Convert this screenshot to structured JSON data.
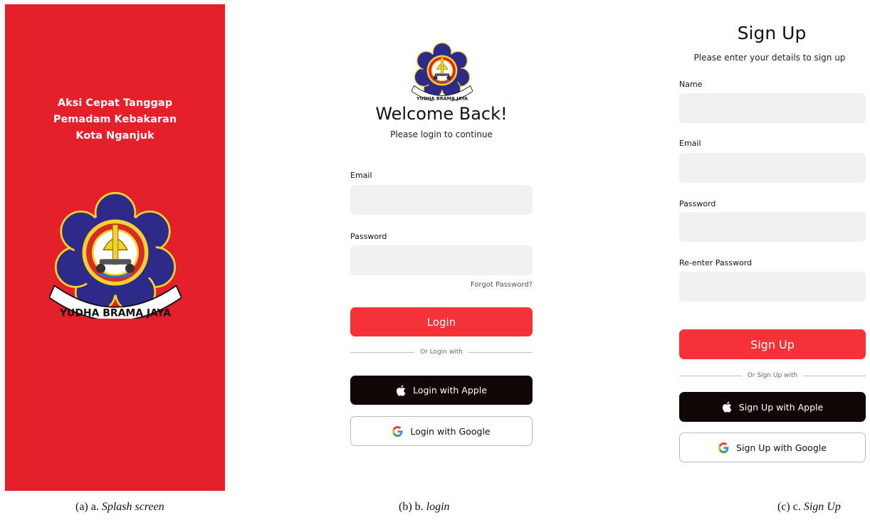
{
  "splash": {
    "title_lines": [
      "Aksi Cepat Tanggap",
      "Pemadam Kebakaran",
      "Kota Nganjuk"
    ],
    "logo_text": "YUDHA BRAMA JAYA",
    "bg_color": "#e4202a"
  },
  "login": {
    "title": "Welcome Back!",
    "subtitle": "Please login to continue",
    "email_label": "Email",
    "password_label": "Password",
    "email_value": "",
    "password_value": "",
    "forgot": "Forgot Password?",
    "login_button": "Login",
    "divider": "Or Login with",
    "apple_button": "Login with Apple",
    "google_button": "Login with Google"
  },
  "signup": {
    "title": "Sign Up",
    "subtitle": "Please enter your details to sign up",
    "name_label": "Name",
    "email_label": "Email",
    "password_label": "Password",
    "reenter_label": "Re-enter Password",
    "signup_button": "Sign Up",
    "divider": "Or Sign Up with",
    "apple_button": "Sign Up with Apple",
    "google_button": "Sign Up with Google"
  },
  "captions": {
    "a_prefix": "(a) a.",
    "a_name": "Splash screen",
    "b_prefix": "(b) b.",
    "b_name": "login",
    "c_prefix": "(c) c.",
    "c_name": "Sign Up"
  },
  "colors": {
    "primary": "#f53238",
    "dark_button": "#110606",
    "field_bg": "#f1f1f1"
  },
  "icons": {
    "apple": "apple-icon",
    "google": "google-icon",
    "logo": "fire-department-emblem-icon"
  }
}
